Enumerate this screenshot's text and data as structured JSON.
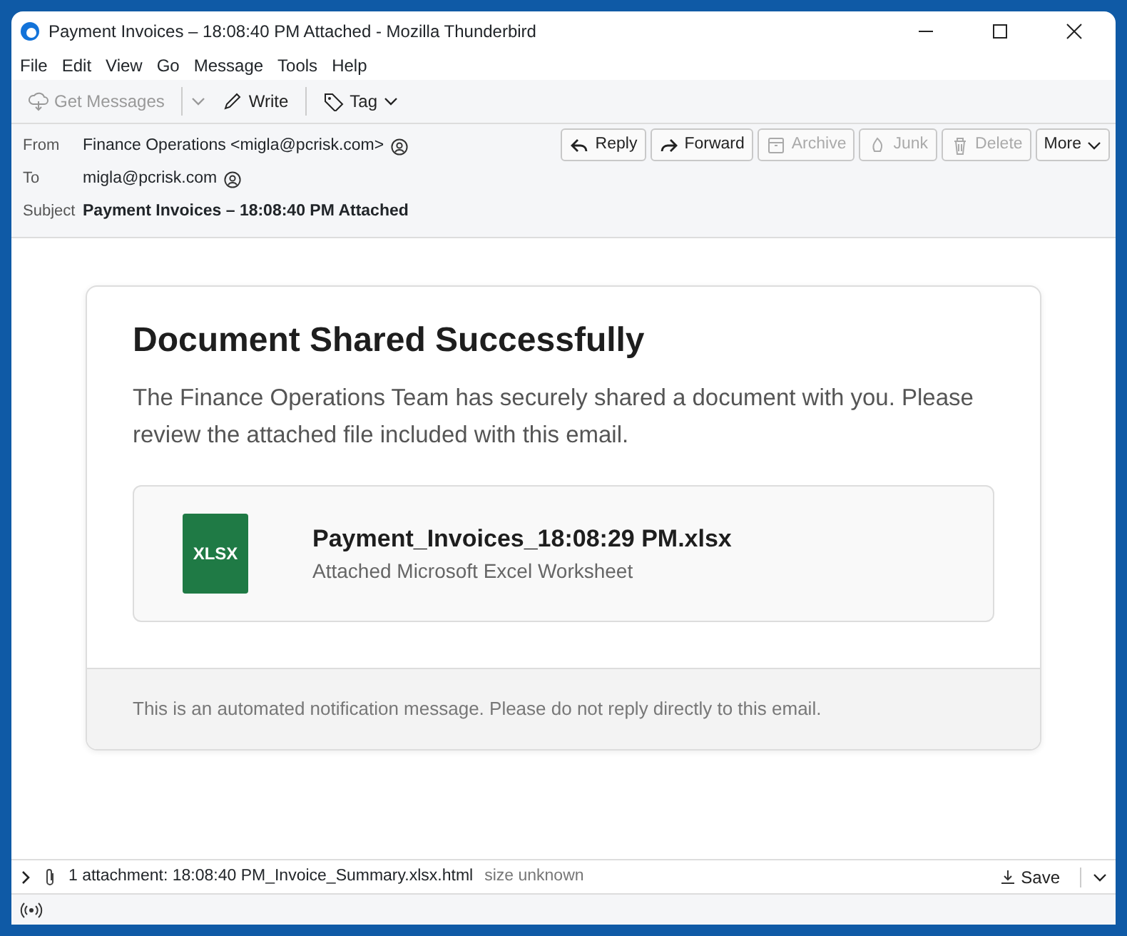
{
  "window": {
    "title": "Payment Invoices – 18:08:40 PM Attached - Mozilla Thunderbird"
  },
  "menu": [
    "File",
    "Edit",
    "View",
    "Go",
    "Message",
    "Tools",
    "Help"
  ],
  "toolbar": [
    {
      "kind": "get",
      "label": "Get Messages",
      "disabled": true
    },
    {
      "kind": "write",
      "label": "Write",
      "disabled": false
    },
    {
      "kind": "tag",
      "label": "Tag",
      "disabled": false
    }
  ],
  "header": {
    "fields": [
      {
        "label": "From",
        "value": "Finance Operations <migla@pcrisk.com>",
        "bold": false
      },
      {
        "label": "To",
        "value": "migla@pcrisk.com",
        "bold": false
      },
      {
        "label": "Subject",
        "value": "Payment Invoices – 18:08:40 PM Attached",
        "bold": true
      }
    ],
    "actions": [
      {
        "kind": "reply",
        "label": "Reply",
        "disabled": false
      },
      {
        "kind": "forward",
        "label": "Forward",
        "disabled": false
      },
      {
        "kind": "archive",
        "label": "Archive",
        "disabled": true
      },
      {
        "kind": "junk",
        "label": "Junk",
        "disabled": true
      },
      {
        "kind": "delete",
        "label": "Delete",
        "disabled": true
      },
      {
        "kind": "more",
        "label": "More",
        "disabled": false
      }
    ]
  },
  "message": {
    "heading": "Document Shared Successfully",
    "text": "The Finance Operations Team has securely shared a document with you. Please review the attached file included with this email.",
    "file": {
      "badge": "XLSX",
      "name": "Payment_Invoices_18:08:29 PM.xlsx",
      "description": "Attached Microsoft Excel Worksheet"
    },
    "footer": "This is an automated notification message. Please do not reply directly to this email."
  },
  "attachment_bar": {
    "summary": "1 attachment: 18:08:40 PM_Invoice_Summary.xlsx.html",
    "size": "size unknown",
    "save": "Save"
  }
}
